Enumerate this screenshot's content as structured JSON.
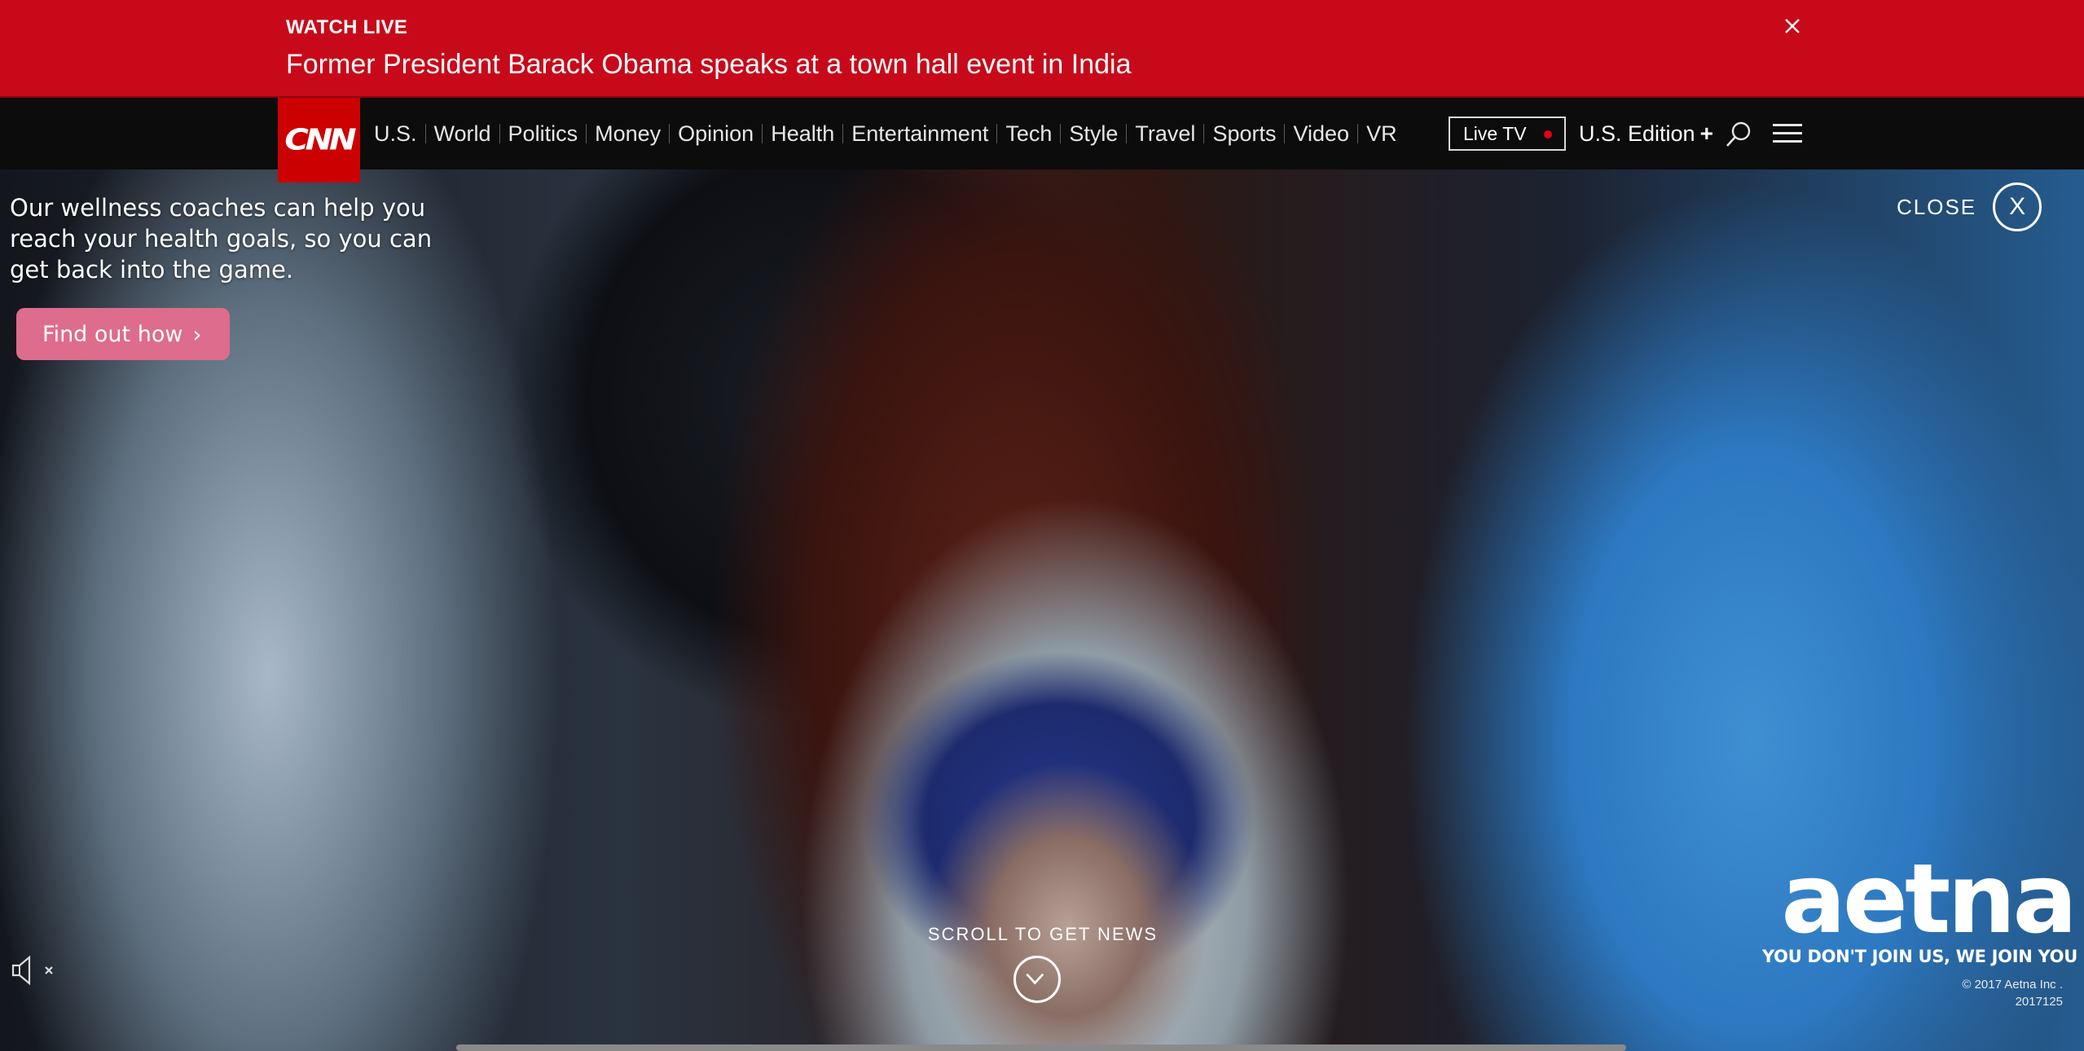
{
  "banner": {
    "kicker": "WATCH LIVE",
    "headline": "Former President Barack Obama speaks at a town hall event in India",
    "close_icon": "close-icon",
    "color": "#c8091a"
  },
  "nav": {
    "logo": "CNN",
    "logo_color": "#cc0000",
    "links": [
      "U.S.",
      "World",
      "Politics",
      "Money",
      "Opinion",
      "Health",
      "Entertainment",
      "Tech",
      "Style",
      "Travel",
      "Sports",
      "Video",
      "VR"
    ],
    "live_tv": "Live TV",
    "edition": "U.S. Edition",
    "edition_plus": "+",
    "search_icon": "search-icon",
    "menu_icon": "hamburger-menu-icon"
  },
  "ad": {
    "copy": "Our wellness coaches can help you reach your health goals, so you can get back into the game.",
    "cta_label": "Find out how",
    "cta_chevron": "›",
    "close_label": "CLOSE",
    "close_symbol": "X",
    "mute_icon": "speaker-muted-icon",
    "scroll_label": "SCROLL TO GET NEWS",
    "scroll_icon": "chevron-down-icon",
    "brand_logo": "aetna",
    "brand_tagline": "YOU DON'T JOIN US, WE JOIN YOU",
    "brand_copyright": "© 2017 Aetna Inc .",
    "brand_code": "2017125",
    "cta_color": "#de6c8c"
  }
}
